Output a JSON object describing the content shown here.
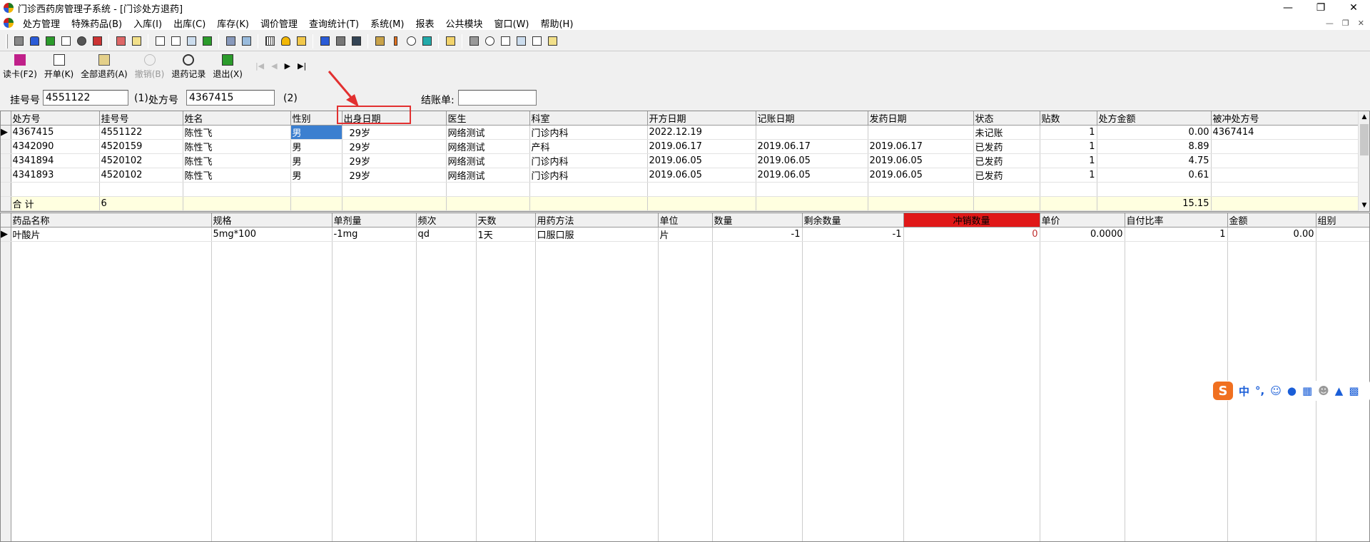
{
  "window": {
    "title": "门诊西药房管理子系统 - [门诊处方退药]"
  },
  "menus": [
    "处方管理",
    "特殊药品(B)",
    "入库(I)",
    "出库(C)",
    "库存(K)",
    "调价管理",
    "查询统计(T)",
    "系统(M)",
    "报表",
    "公共模块",
    "窗口(W)",
    "帮助(H)"
  ],
  "actions": [
    {
      "label": "读卡(F2)",
      "enabled": true
    },
    {
      "label": "开单(K)",
      "enabled": true
    },
    {
      "label": "全部退药(A)",
      "enabled": true
    },
    {
      "label": "撤销(B)",
      "enabled": false
    },
    {
      "label": "退药记录",
      "enabled": true
    },
    {
      "label": "退出(X)",
      "enabled": true
    }
  ],
  "form": {
    "reg_label": "挂号号",
    "reg_value": "4551122",
    "opt1": "(1)",
    "rx_label": "处方号",
    "rx_value": "4367415",
    "opt2": "(2)",
    "bill_label": "结账单:",
    "bill_value": ""
  },
  "top_grid": {
    "headers": [
      "处方号",
      "挂号号",
      "姓名",
      "性别",
      "出身日期",
      "医生",
      "科室",
      "开方日期",
      "记账日期",
      "发药日期",
      "状态",
      "贴数",
      "处方金额",
      "被冲处方号"
    ],
    "rows": [
      [
        "4367415",
        "4551122",
        "陈性飞",
        "男",
        "29岁",
        "网络测试",
        "门诊内科",
        "2022.12.19",
        "",
        "",
        "未记账",
        "1",
        "0.00",
        "4367414"
      ],
      [
        "4342090",
        "4520159",
        "陈性飞",
        "男",
        "29岁",
        "网络测试",
        "产科",
        "2019.06.17",
        "2019.06.17",
        "2019.06.17",
        "已发药",
        "1",
        "8.89",
        ""
      ],
      [
        "4341894",
        "4520102",
        "陈性飞",
        "男",
        "29岁",
        "网络测试",
        "门诊内科",
        "2019.06.05",
        "2019.06.05",
        "2019.06.05",
        "已发药",
        "1",
        "4.75",
        ""
      ],
      [
        "4341893",
        "4520102",
        "陈性飞",
        "男",
        "29岁",
        "网络测试",
        "门诊内科",
        "2019.06.05",
        "2019.06.05",
        "2019.06.05",
        "已发药",
        "1",
        "0.61",
        ""
      ]
    ],
    "summary": {
      "label": "合 计",
      "count": "6",
      "total": "15.15"
    }
  },
  "bottom_grid": {
    "headers": [
      "药品名称",
      "规格",
      "单剂量",
      "频次",
      "天数",
      "用药方法",
      "单位",
      "数量",
      "剩余数量",
      "冲销数量",
      "单价",
      "自付比率",
      "金额",
      "组别"
    ],
    "rows": [
      [
        "叶酸片",
        "5mg*100",
        "-1mg",
        "qd",
        "1天",
        "口服口服",
        "片",
        "-1",
        "-1",
        "0",
        "0.0000",
        "1",
        "0.00",
        ""
      ]
    ]
  },
  "ime": {
    "mode": "中",
    "punct": "°,"
  }
}
